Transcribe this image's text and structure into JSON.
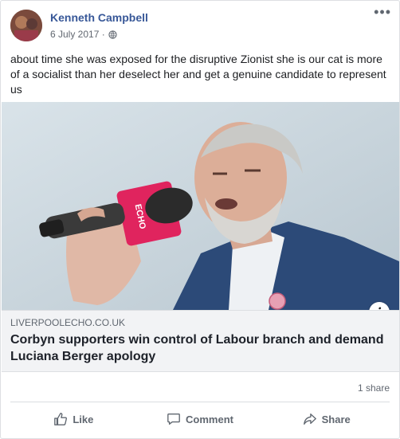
{
  "post": {
    "author": "Kenneth Campbell",
    "date": "6 July 2017 · ",
    "privacy_icon": "globe-icon",
    "text": "about time she was exposed for the disruptive Zionist she is our cat is more of a socialist than her deselect her and get a genuine candidate to represent us",
    "more_label": "•••"
  },
  "link": {
    "domain": "LIVERPOOLECHO.CO.UK",
    "headline": "Corbyn supporters win control of Labour branch and demand Luciana Berger apology",
    "info_label": "i",
    "image_text": "ECHO"
  },
  "stats": {
    "shares": "1 share"
  },
  "actions": {
    "like": "Like",
    "comment": "Comment",
    "share": "Share"
  },
  "colors": {
    "author": "#385898",
    "mic": "#e0245e",
    "jacket": "#2c4a78"
  }
}
